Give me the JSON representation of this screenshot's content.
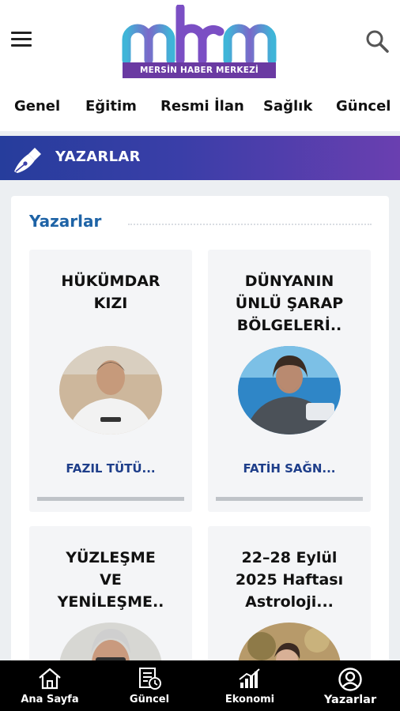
{
  "header": {
    "brand_text": "MERSİN HABER MERKEZİ",
    "menu_icon": "hamburger-menu-icon",
    "search_icon": "search-icon"
  },
  "categories": [
    "Genel",
    "Eğitim",
    "Resmi İlan",
    "Sağlık",
    "Güncel"
  ],
  "section": {
    "title": "YAZARLAR",
    "icon": "pen-nib-icon",
    "gradient_start": "#263d9c",
    "gradient_end": "#6a3fb0"
  },
  "panel": {
    "title": "Yazarlar"
  },
  "cards": [
    {
      "title_lines": [
        "HÜKÜMDAR",
        "KIZI"
      ],
      "author": "FAZIL TÜTÜ..."
    },
    {
      "title_lines": [
        "DÜNYANIN",
        "ÜNLÜ ŞARAP",
        "BÖLGELERİ.."
      ],
      "author": "FATİH SAĞN..."
    },
    {
      "title_lines": [
        "YÜZLEŞME",
        "VE",
        "YENİLEŞME.."
      ],
      "author": ""
    },
    {
      "title_lines": [
        "22–28 Eylül",
        "2025 Haftası",
        "Astroloji..."
      ],
      "author": ""
    }
  ],
  "bottom_nav": [
    {
      "label": "Ana Sayfa",
      "icon": "home-icon",
      "active": false
    },
    {
      "label": "Güncel",
      "icon": "newspaper-clock-icon",
      "active": false
    },
    {
      "label": "Ekonomi",
      "icon": "chart-growth-icon",
      "active": false
    },
    {
      "label": "Yazarlar",
      "icon": "user-circle-icon",
      "active": true
    }
  ],
  "colors": {
    "accent_blue": "#1e63a6",
    "author_blue": "#1e3e8a",
    "brand_purple": "#6a3aa2",
    "logo_teal": "#3fb5d8"
  }
}
